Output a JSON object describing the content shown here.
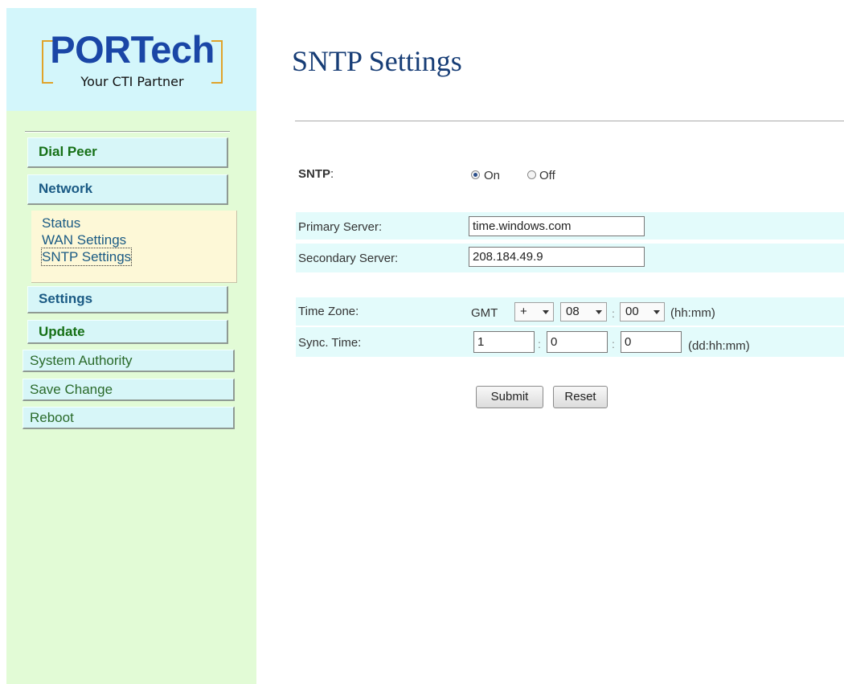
{
  "brand": {
    "name": "PORTech",
    "tagline": "Your CTI Partner"
  },
  "sidebar": {
    "items": [
      {
        "label": "Dial Peer"
      },
      {
        "label": "Network"
      },
      {
        "label": "Settings"
      },
      {
        "label": "Update"
      },
      {
        "label": "System Authority"
      },
      {
        "label": "Save Change"
      },
      {
        "label": "Reboot"
      }
    ],
    "network_submenu": [
      {
        "label": "Status"
      },
      {
        "label": "WAN Settings"
      },
      {
        "label": "SNTP Settings",
        "active": true
      }
    ]
  },
  "page": {
    "title": "SNTP Settings"
  },
  "form": {
    "sntp": {
      "label": "SNTP",
      "label_suffix": ":",
      "on_label": "On",
      "off_label": "Off",
      "selected": "On"
    },
    "primary_server": {
      "label": "Primary Server:",
      "value": "time.windows.com"
    },
    "secondary_server": {
      "label": "Secondary Server:",
      "value": "208.184.49.9"
    },
    "time_zone": {
      "label": "Time Zone:",
      "prefix": "GMT",
      "sign": "+",
      "hours": "08",
      "minutes": "00",
      "separator": ":",
      "format": "(hh:mm)"
    },
    "sync_time": {
      "label": "Sync. Time:",
      "days": "1",
      "hours": "0",
      "minutes": "0",
      "separator": ":",
      "format": "(dd:hh:mm)"
    },
    "buttons": {
      "submit": "Submit",
      "reset": "Reset"
    }
  }
}
